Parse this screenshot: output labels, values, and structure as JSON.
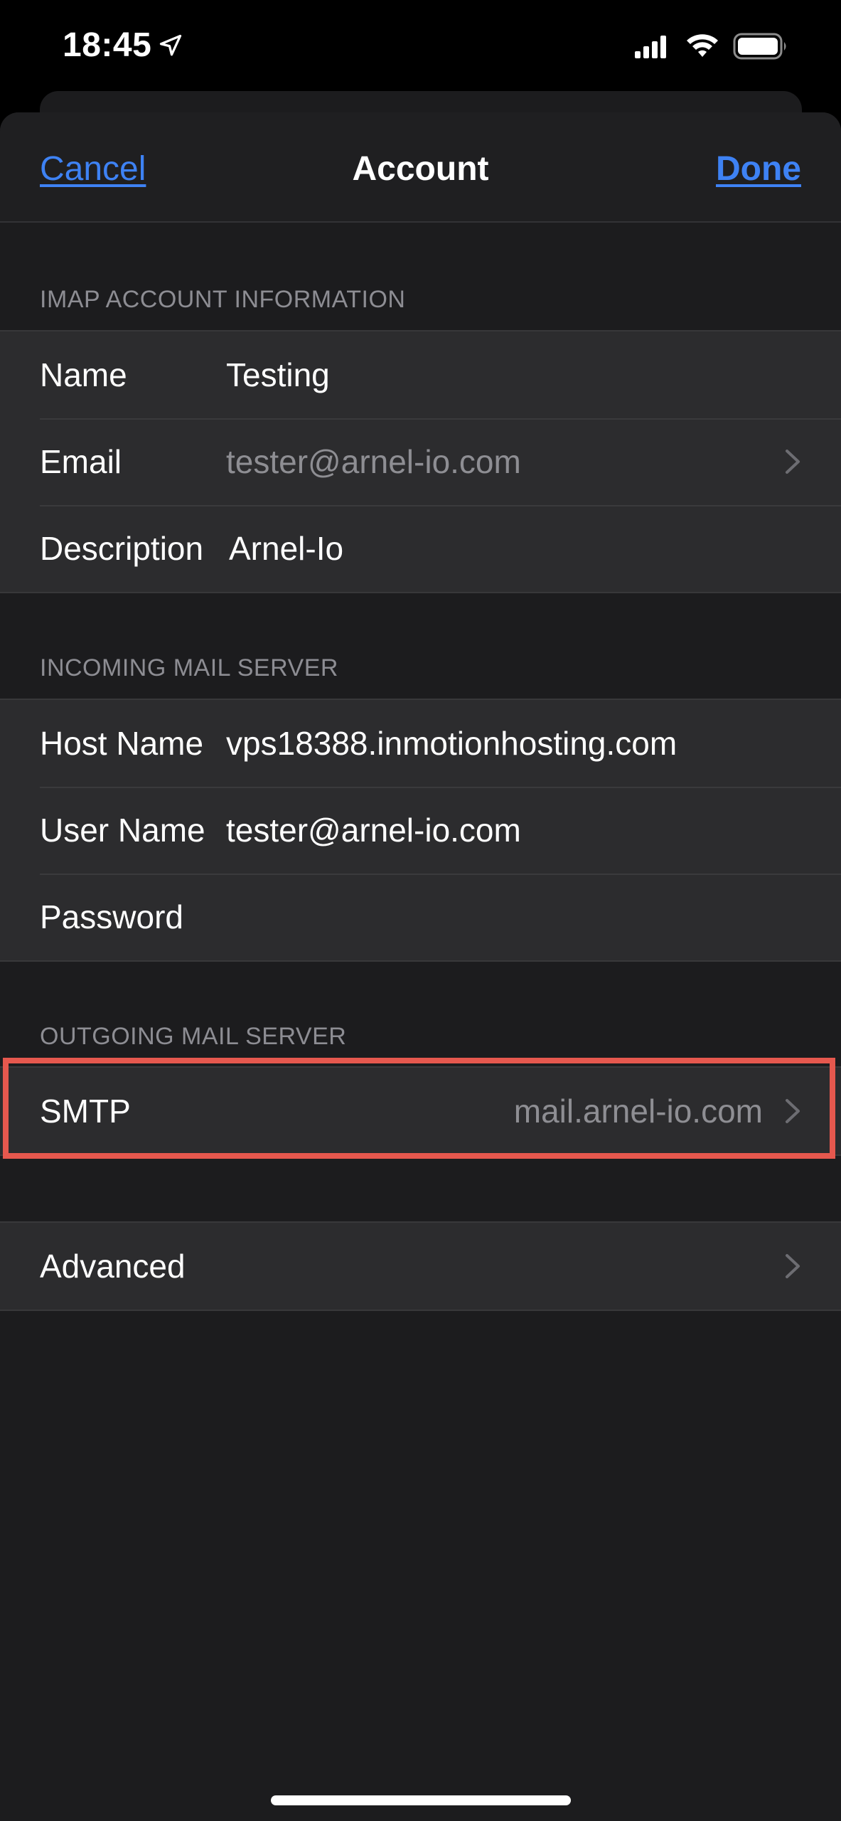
{
  "status_bar": {
    "time": "18:45",
    "icons": [
      "location-arrow-icon",
      "cellular-signal-icon",
      "wifi-icon",
      "battery-icon"
    ]
  },
  "nav": {
    "cancel_label": "Cancel",
    "title": "Account",
    "done_label": "Done"
  },
  "imap_section": {
    "header": "IMAP ACCOUNT INFORMATION",
    "rows": [
      {
        "label": "Name",
        "value": "Testing"
      },
      {
        "label": "Email",
        "value": "tester@arnel-io.com"
      },
      {
        "label": "Description",
        "value": "Arnel-Io"
      }
    ]
  },
  "incoming_section": {
    "header": "INCOMING MAIL SERVER",
    "rows": [
      {
        "label": "Host Name",
        "value": "vps18388.inmotionhosting.com"
      },
      {
        "label": "User Name",
        "value": "tester@arnel-io.com"
      },
      {
        "label": "Password",
        "value": ""
      }
    ]
  },
  "outgoing_section": {
    "header": "OUTGOING MAIL SERVER",
    "smtp_label": "SMTP",
    "smtp_value": "mail.arnel-io.com"
  },
  "advanced": {
    "label": "Advanced"
  },
  "colors": {
    "accent": "#3e82f4",
    "highlight": "#e6584e",
    "background": "#1c1c1e",
    "cell": "#2c2c2e"
  }
}
